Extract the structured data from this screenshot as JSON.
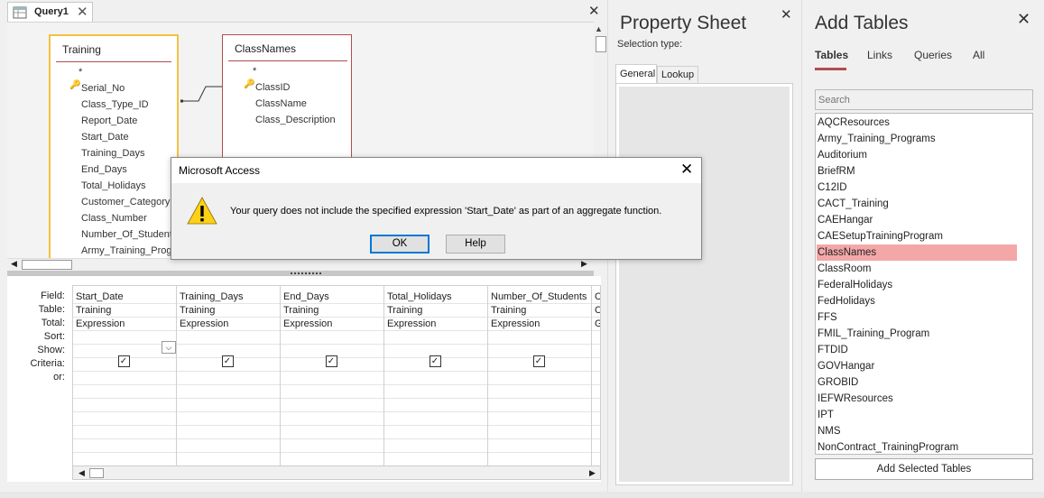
{
  "query_tab": {
    "label": "Query1"
  },
  "field_lists": {
    "training": {
      "title": "Training",
      "fields": [
        "*",
        "Serial_No",
        "Class_Type_ID",
        "Report_Date",
        "Start_Date",
        "Training_Days",
        "End_Days",
        "Total_Holidays",
        "Customer_Category",
        "Class_Number",
        "Number_Of_Students",
        "Army_Training_Prog"
      ]
    },
    "classnames": {
      "title": "ClassNames",
      "fields": [
        "*",
        "ClassID",
        "ClassName",
        "Class_Description"
      ]
    }
  },
  "grid": {
    "row_labels": [
      "Field:",
      "Table:",
      "Total:",
      "Sort:",
      "Show:",
      "Criteria:",
      "or:"
    ],
    "columns": [
      {
        "field": "Start_Date",
        "table": "Training",
        "total": "Expression",
        "show": true
      },
      {
        "field": "Training_Days",
        "table": "Training",
        "total": "Expression",
        "show": true
      },
      {
        "field": "End_Days",
        "table": "Training",
        "total": "Expression",
        "show": true
      },
      {
        "field": "Total_Holidays",
        "table": "Training",
        "total": "Expression",
        "show": true
      },
      {
        "field": "Number_Of_Students",
        "table": "Training",
        "total": "Expression",
        "show": true
      },
      {
        "field": "C",
        "table": "C",
        "total": "G",
        "show": false
      }
    ]
  },
  "property_sheet": {
    "title": "Property Sheet",
    "selection_type_label": "Selection type:",
    "tabs": [
      "General",
      "Lookup"
    ]
  },
  "add_tables": {
    "title": "Add Tables",
    "tabs": [
      "Tables",
      "Links",
      "Queries",
      "All"
    ],
    "search_placeholder": "Search",
    "items": [
      "AQCResources",
      "Army_Training_Programs",
      "Auditorium",
      "BriefRM",
      "C12ID",
      "CACT_Training",
      "CAEHangar",
      "CAESetupTrainingProgram",
      "ClassNames",
      "ClassRoom",
      "FederalHolidays",
      "FedHolidays",
      "FFS",
      "FMIL_Training_Program",
      "FTDID",
      "GOVHangar",
      "GROBID",
      "IEFWResources",
      "IPT",
      "NMS",
      "NonContract_TrainingProgram"
    ],
    "selected_item": "ClassNames",
    "add_button": "Add Selected Tables"
  },
  "dialog": {
    "title": "Microsoft Access",
    "message": "Your query does not include the specified expression 'Start_Date' as part of an aggregate function.",
    "ok": "OK",
    "help": "Help"
  },
  "colors": {
    "accent": "#b24c4c",
    "selected_row": "#f4a7a7",
    "focus_border": "#0078d7"
  }
}
